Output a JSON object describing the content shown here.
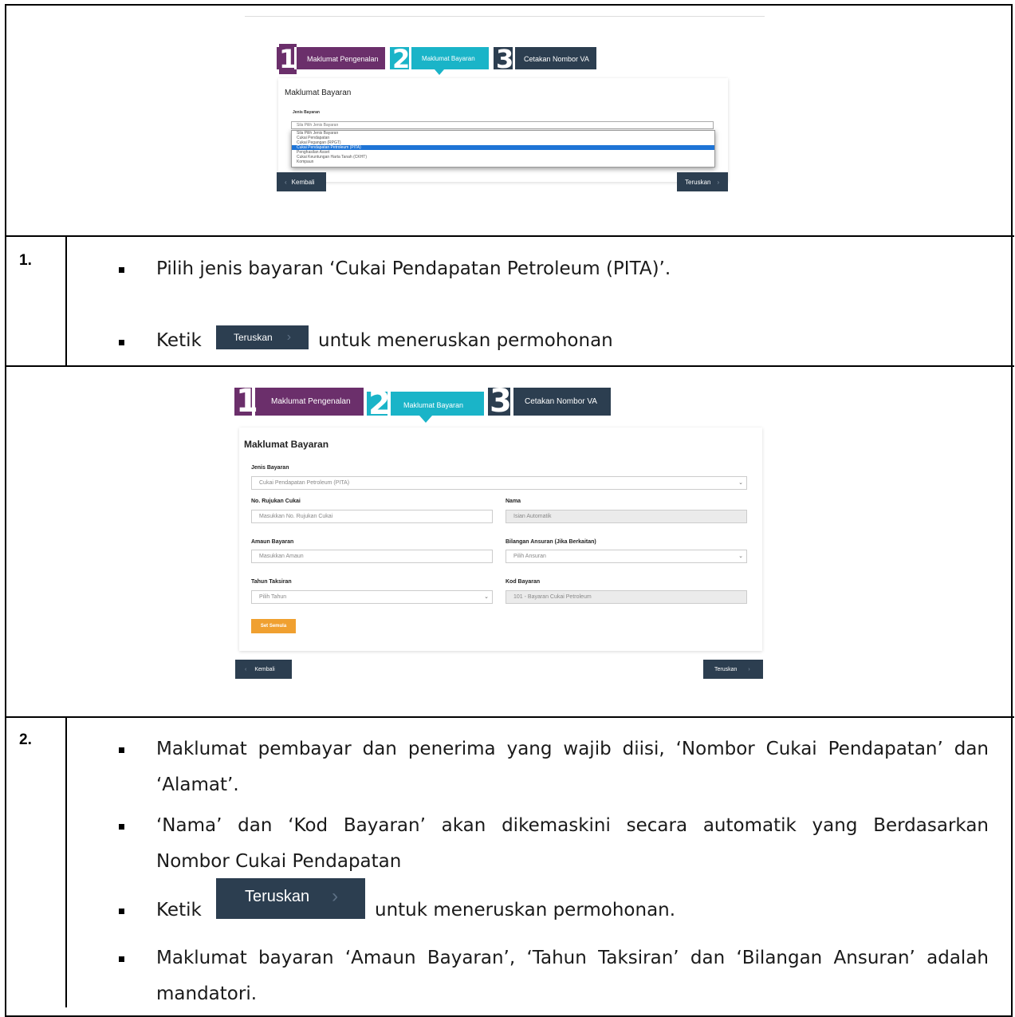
{
  "screenshot1": {
    "steps": [
      {
        "digit": "1",
        "label": "Maklumat Pengenalan",
        "color": "#6b2f6b"
      },
      {
        "digit": "2",
        "label": "Maklumat Bayaran",
        "color": "#1ab4c8"
      },
      {
        "digit": "3",
        "label": "Cetakan Nombor VA",
        "color": "#2c3e50"
      }
    ],
    "panel_title": "Maklumat Bayaran",
    "field_label": "Jenis Bayaran",
    "select_value": "Sila Pilih Jenis Bayaran",
    "options": [
      "Sila Pilih Jenis Bayaran",
      "Cukai Pendapatan",
      "Cukai Pegangan (RPGT)",
      "Cukai Pendapatan Petroleum (PITA)",
      "Penghasilan Asset",
      "Cukai Keuntungan Harta Tanah (CKHT)",
      "Kompaun"
    ],
    "selected_option_index": 3,
    "back_label": "Kembali",
    "next_label": "Teruskan"
  },
  "item1": {
    "number": "1.",
    "bullet1": "Pilih jenis bayaran ‘Cukai Pendapatan Petroleum (PITA)’.",
    "bullet2_before": "Ketik",
    "bullet2_button": "Teruskan",
    "bullet2_after": "untuk meneruskan permohonan"
  },
  "screenshot2": {
    "steps": [
      {
        "digit": "1",
        "label": "Maklumat Pengenalan",
        "color": "#6b2f6b"
      },
      {
        "digit": "2",
        "label": "Maklumat Bayaran",
        "color": "#1ab4c8"
      },
      {
        "digit": "3",
        "label": "Cetakan Nombor VA",
        "color": "#2c3e50"
      }
    ],
    "panel_title": "Maklumat Bayaran",
    "jenis_label": "Jenis Bayaran",
    "jenis_value": "Cukai Pendapatan Petroleum (PITA)",
    "rujukan_label": "No. Rujukan Cukai",
    "rujukan_placeholder": "Masukkan No. Rujukan Cukai",
    "nama_label": "Nama",
    "nama_value": "Isian Automatik",
    "amaun_label": "Amaun Bayaran",
    "amaun_placeholder": "Masukkan Amaun",
    "ansuran_label": "Bilangan Ansuran (Jika Berkaitan)",
    "ansuran_value": "Pilih Ansuran",
    "tahun_label": "Tahun Taksiran",
    "tahun_value": "Pilih Tahun",
    "kod_label": "Kod Bayaran",
    "kod_value": "101 - Bayaran Cukai Petroleum",
    "reset_label": "Set Semula",
    "back_label": "Kembali",
    "next_label": "Teruskan",
    "reset_color": "#f0a030"
  },
  "item2": {
    "number": "2.",
    "bullet1_line1": "Maklumat pembayar dan penerima yang wajib diisi, ‘Nombor Cukai Pendapatan’ dan",
    "bullet1_line2": "‘Alamat’.",
    "bullet2_line1": "‘Nama’ dan ‘Kod Bayaran’ akan dikemaskini secara automatik yang Berdasarkan",
    "bullet2_line2": "Nombor Cukai Pendapatan",
    "bullet3_before": "Ketik",
    "bullet3_button": "Teruskan",
    "bullet3_after": "untuk meneruskan permohonan.",
    "bullet4_line1": "Maklumat bayaran ‘Amaun Bayaran’, ‘Tahun Taksiran’ dan ‘Bilangan Ansuran’ adalah",
    "bullet4_line2": "mandatori."
  }
}
